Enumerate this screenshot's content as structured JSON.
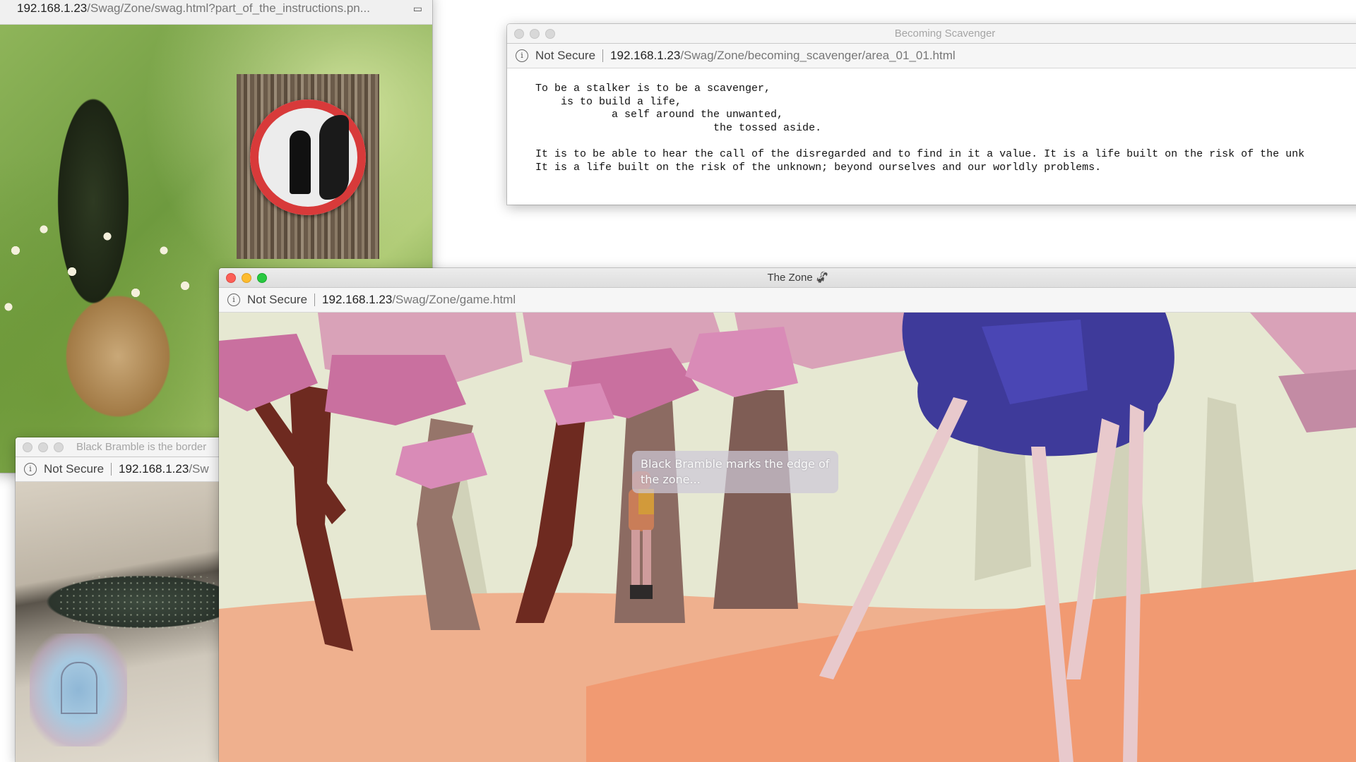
{
  "windows": {
    "swag": {
      "url_host": "192.168.1.23",
      "url_path": "/Swag/Zone/swag.html?part_of_the_instructions.pn...",
      "reader_icon": "reader-icon"
    },
    "scavenger": {
      "title": "Becoming Scavenger",
      "security": "Not Secure",
      "url_host": "192.168.1.23",
      "url_path": "/Swag/Zone/becoming_scavenger/area_01_01.html",
      "text": "To be a stalker is to be a scavenger,\n    is to build a life,\n            a self around the unwanted,\n                            the tossed aside.\n\nIt is to be able to hear the call of the disregarded and to find in it a value. It is a life built on the risk of the unk\nIt is a life built on the risk of the unknown; beyond ourselves and our worldly problems."
    },
    "bramble": {
      "title": "Black Bramble is the border",
      "security": "Not Secure",
      "url_host": "192.168.1.23",
      "url_path": "/Sw"
    },
    "zone": {
      "title": "The Zone 🦨",
      "security": "Not Secure",
      "url_host": "192.168.1.23",
      "url_path": "/Swag/Zone/game.html",
      "dialogue": "Black Bramble marks the edge of the zone..."
    }
  },
  "colors": {
    "sky": "#e6e8d2",
    "sand": "#f19a72",
    "trunk": "#6e2a20",
    "canopy_pink": "#c9709f",
    "canopy_blue": "#3e3a9a",
    "leg": "#e8c9cc"
  }
}
